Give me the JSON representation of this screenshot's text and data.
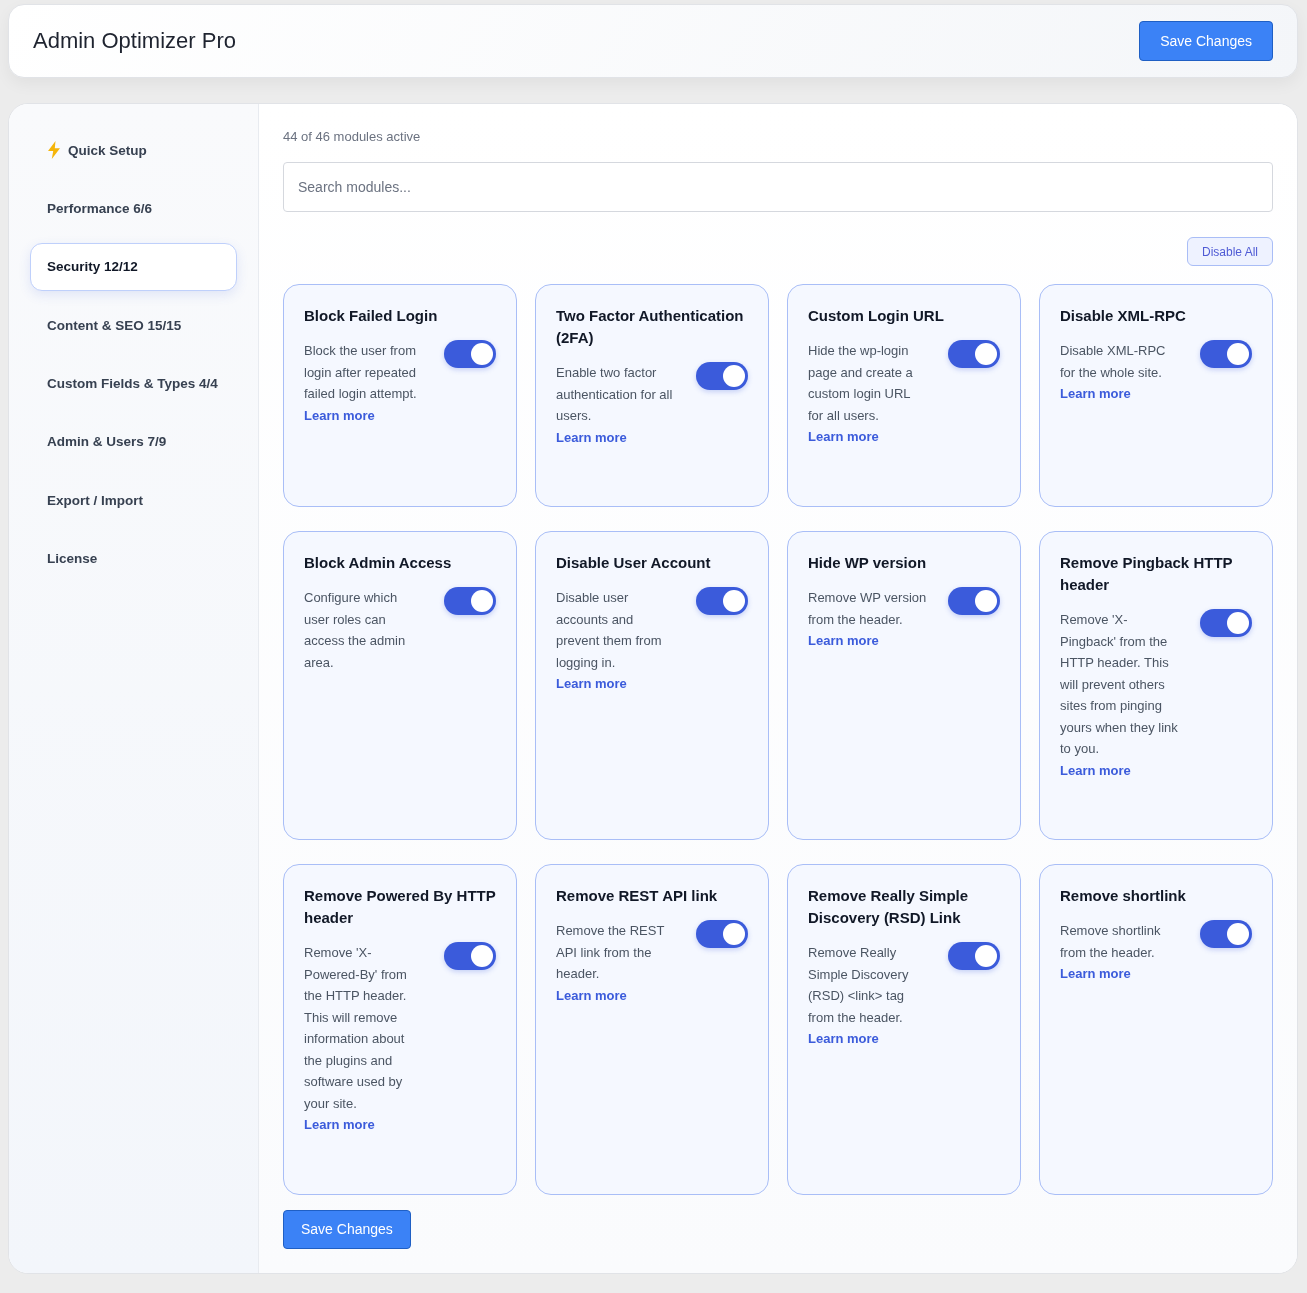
{
  "header": {
    "title": "Admin Optimizer Pro",
    "save_button": "Save Changes"
  },
  "sidebar": {
    "items": [
      {
        "label": "Quick Setup",
        "kind": "setup",
        "selected": false
      },
      {
        "label": "Performance 6/6",
        "kind": "section",
        "selected": false
      },
      {
        "label": "Security 12/12",
        "kind": "section",
        "selected": true
      },
      {
        "label": "Content & SEO 15/15",
        "kind": "section",
        "selected": false
      },
      {
        "label": "Custom Fields & Types 4/4",
        "kind": "section",
        "selected": false
      },
      {
        "label": "Admin & Users 7/9",
        "kind": "section",
        "selected": false
      },
      {
        "label": "Export / Import",
        "kind": "section",
        "selected": false
      },
      {
        "label": "License",
        "kind": "section",
        "selected": false
      }
    ]
  },
  "content": {
    "status": "44 of 46 modules active",
    "search": {
      "placeholder": "Search modules..."
    },
    "disable_all_button": "Disable All",
    "modules": [
      {
        "title": "Block Failed Login",
        "description": "Block the user from login after repeated failed login attempt.",
        "on": true,
        "link": "Learn more"
      },
      {
        "title": "Two Factor Authentication (2FA)",
        "description": "Enable two factor authentication for all users.",
        "on": true,
        "link": "Learn more"
      },
      {
        "title": "Custom Login URL",
        "description": "Hide the wp-login page and create a custom login URL for all users.",
        "on": true,
        "link": "Learn more"
      },
      {
        "title": "Disable XML-RPC",
        "description": "Disable XML-RPC for the whole site.",
        "on": true,
        "link": "Learn more"
      },
      {
        "title": "Block Admin Access",
        "description": "Configure which user roles can access the admin area.",
        "on": true
      },
      {
        "title": "Disable User Account",
        "description": "Disable user accounts and prevent them from logging in.",
        "on": true,
        "link": "Learn more"
      },
      {
        "title": "Hide WP version",
        "description": "Remove WP version from the header.",
        "on": true,
        "link": "Learn more"
      },
      {
        "title": "Remove Pingback HTTP header",
        "description": "Remove 'X-Pingback' from the HTTP header. This will prevent others sites from pinging yours when they link to you.",
        "on": true,
        "link": "Learn more"
      },
      {
        "title": "Remove Powered By HTTP header",
        "description": "Remove 'X-Powered-By' from the HTTP header. This will remove information about the plugins and software used by your site.",
        "on": true,
        "link": "Learn more"
      },
      {
        "title": "Remove REST API link",
        "description": "Remove the REST API link from the header.",
        "on": true,
        "link": "Learn more"
      },
      {
        "title": "Remove Really Simple Discovery (RSD) Link",
        "description": "Remove Really Simple Discovery (RSD) <link> tag from the header.",
        "on": true,
        "link": "Learn more"
      },
      {
        "title": "Remove shortlink",
        "description": "Remove shortlink from the header.",
        "on": true,
        "link": "Learn more"
      }
    ],
    "save_button": "Save Changes"
  }
}
